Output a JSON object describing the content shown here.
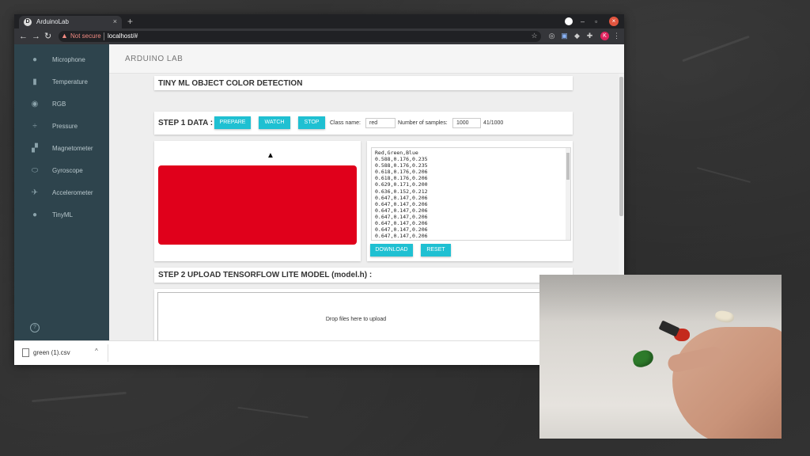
{
  "browser": {
    "tab_title": "ArduinoLab",
    "new_tab": "+",
    "not_secure": "Not secure",
    "url": "localhost/#",
    "profile_initial": "K"
  },
  "sidebar": {
    "items": [
      {
        "label": "Microphone",
        "icon": "microphone-icon"
      },
      {
        "label": "Temperature",
        "icon": "thermometer-icon"
      },
      {
        "label": "RGB",
        "icon": "eye-icon"
      },
      {
        "label": "Pressure",
        "icon": "pressure-icon"
      },
      {
        "label": "Magnetometer",
        "icon": "magnetometer-icon"
      },
      {
        "label": "Gyroscope",
        "icon": "gyroscope-icon"
      },
      {
        "label": "Accelerometer",
        "icon": "runner-icon"
      },
      {
        "label": "TinyML",
        "icon": "lightbulb-icon"
      }
    ]
  },
  "app": {
    "title": "ARDUINO LAB"
  },
  "header_card": {
    "title": "TINY ML OBJECT COLOR DETECTION"
  },
  "step1": {
    "title": "STEP 1 DATA :",
    "prepare_label": "PREPARE",
    "watch_label": "WATCH",
    "stop_label": "STOP",
    "class_name_label": "Class name:",
    "class_name_value": "red",
    "samples_label": "Number of samples:",
    "samples_value": "1000",
    "progress": "41/1000"
  },
  "color_preview": {
    "color": "#e0001b"
  },
  "data_log": {
    "text": "Red,Green,Blue\n0.588,0.176,0.235\n0.588,0.176,0.235\n0.618,0.176,0.206\n0.618,0.176,0.206\n0.629,0.171,0.200\n0.636,0.152,0.212\n0.647,0.147,0.206\n0.647,0.147,0.206\n0.647,0.147,0.206\n0.647,0.147,0.206\n0.647,0.147,0.206\n0.647,0.147,0.206\n0.647,0.147,0.206\n0.647,0.147,0.206",
    "download_label": "DOWNLOAD",
    "reset_label": "RESET"
  },
  "step2": {
    "title": "STEP 2 UPLOAD TENSORFLOW LITE MODEL (model.h) :",
    "drop_text": "Drop files here to upload"
  },
  "downloads": {
    "file_name": "green (1).csv"
  },
  "colors": {
    "sidebar_bg": "#2e444d",
    "accent": "#1fc0d2",
    "detected_color": "#e0001b"
  }
}
